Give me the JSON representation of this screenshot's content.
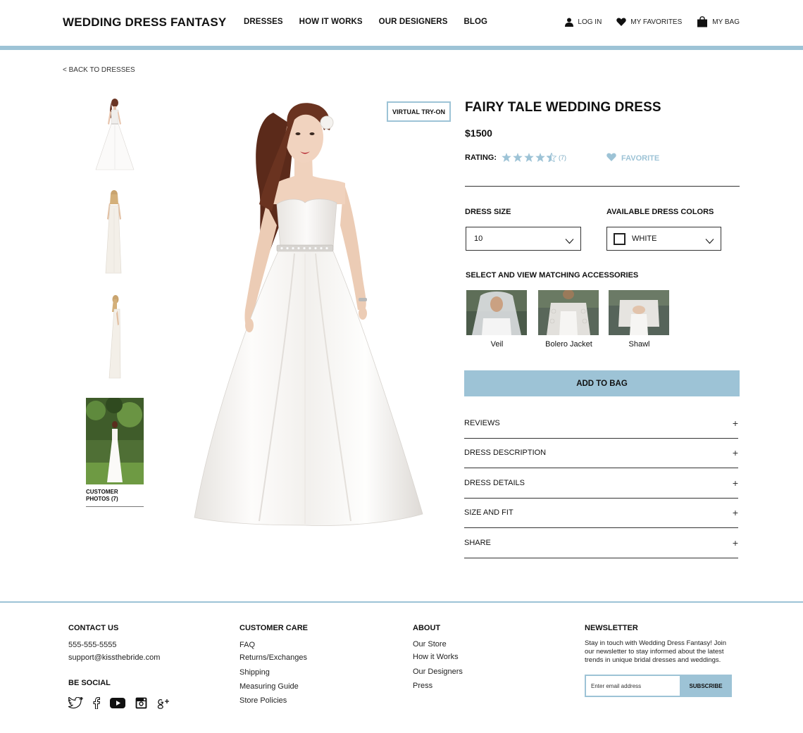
{
  "header": {
    "logo": "WEDDING DRESS FANTASY",
    "nav": [
      "DRESSES",
      "HOW IT WORKS",
      "OUR DESIGNERS",
      "BLOG"
    ],
    "login": "LOG IN",
    "favorites": "MY FAVORITES",
    "bag": "MY BAG"
  },
  "back_link": "< BACK TO DRESSES",
  "gallery": {
    "customer_photos_label": "CUSTOMER PHOTOS (7)"
  },
  "virtual_try_on": "VIRTUAL TRY-ON",
  "product": {
    "title": "FAIRY TALE WEDDING DRESS",
    "price": "$1500",
    "rating_label": "RATING:",
    "rating_value": 4.5,
    "rating_max": 5,
    "rating_count": "(7)",
    "favorite_label": "FAVORITE",
    "size_label": "DRESS SIZE",
    "size_value": "10",
    "colors_label": "AVAILABLE DRESS COLORS",
    "color_value": "WHITE",
    "accessories_label": "SELECT AND VIEW MATCHING ACCESSORIES",
    "accessories": [
      "Veil",
      "Bolero Jacket",
      "Shawl"
    ],
    "add_to_bag": "ADD TO BAG",
    "sections": [
      "REVIEWS",
      "DRESS DESCRIPTION",
      "DRESS DETAILS",
      "SIZE AND FIT",
      "SHARE"
    ],
    "section_icon": "+"
  },
  "footer": {
    "contact": {
      "heading": "CONTACT US",
      "phone": "555-555-5555",
      "email": "support@kissthebride.com",
      "social_heading": "BE SOCIAL",
      "social_icons": [
        "twitter-icon",
        "facebook-icon",
        "youtube-icon",
        "instagram-icon",
        "google-plus-icon"
      ]
    },
    "care": {
      "heading": "CUSTOMER CARE",
      "links": [
        "FAQ",
        "Returns/Exchanges",
        "Shipping",
        "Measuring Guide",
        "Store Policies"
      ]
    },
    "about": {
      "heading": "ABOUT",
      "links": [
        "Our Store",
        "How it Works",
        "Our Designers",
        "Press"
      ]
    },
    "newsletter": {
      "heading": "NEWSLETTER",
      "text": "Stay in touch with Wedding Dress Fantasy! Join our newsletter to stay informed about the latest trends in unique bridal dresses and weddings.",
      "placeholder": "Enter email address",
      "button": "SUBSCRIBE"
    }
  },
  "colors": {
    "accent": "#9dc3d6",
    "text": "#111111"
  }
}
